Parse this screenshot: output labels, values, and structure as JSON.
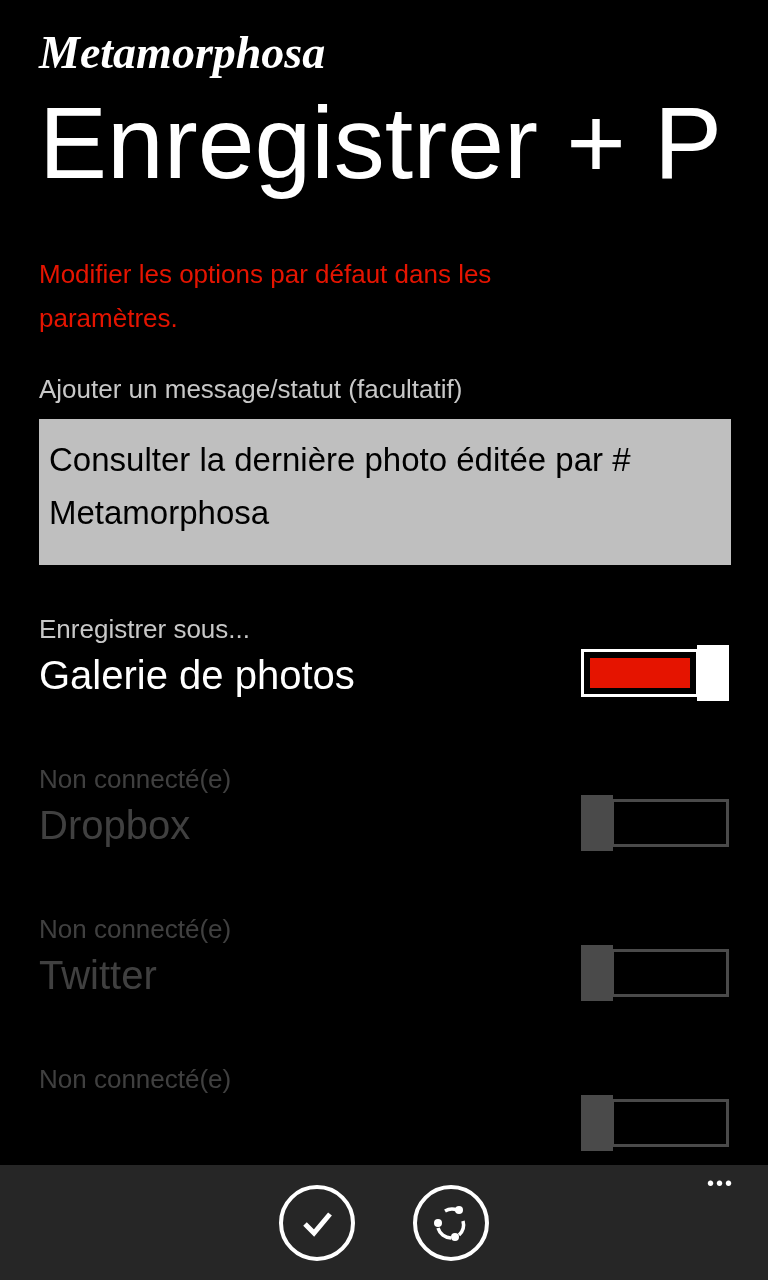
{
  "app_title": "Metamorphosa",
  "page_title": "Enregistrer + P",
  "notice": "Modifier les options par défaut dans les paramètres.",
  "message": {
    "label": "Ajouter un message/statut (facultatif)",
    "value": "Consulter la dernière photo éditée par # Metamorphosa"
  },
  "destinations": [
    {
      "sublabel": "Enregistrer sous...",
      "label": "Galerie de photos",
      "on": true,
      "disabled": false
    },
    {
      "sublabel": "Non connecté(e)",
      "label": "Dropbox",
      "on": false,
      "disabled": true
    },
    {
      "sublabel": "Non connecté(e)",
      "label": "Twitter",
      "on": false,
      "disabled": true
    },
    {
      "sublabel": "Non connecté(e)",
      "on": false,
      "disabled": true
    }
  ],
  "app_bar": {
    "buttons": [
      {
        "kind": "check"
      },
      {
        "kind": "share"
      }
    ],
    "more": "•••"
  }
}
